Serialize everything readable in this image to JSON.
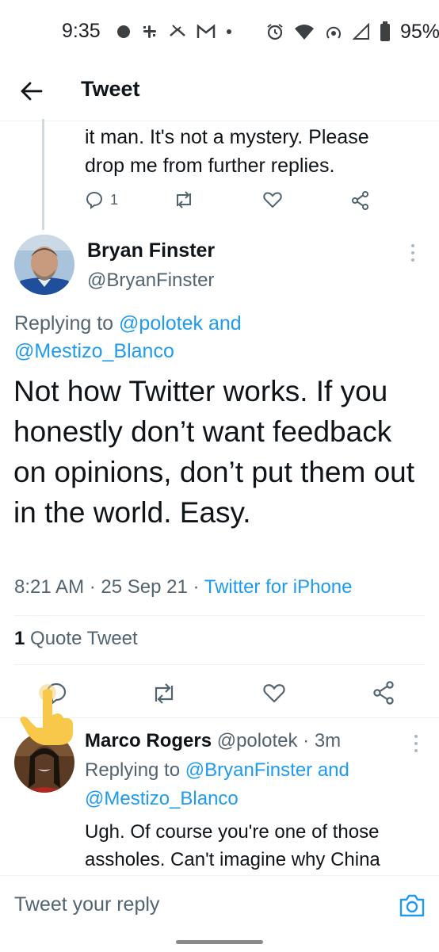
{
  "status_bar": {
    "time": "9:35",
    "battery": "95%"
  },
  "header": {
    "title": "Tweet"
  },
  "previous_tweet": {
    "text_line1": "it man. It's not a mystery. Please",
    "text_line2": "drop me from further replies.",
    "reply_count": "1"
  },
  "main_tweet": {
    "author_name": "Bryan Finster",
    "author_handle": "@BryanFinster",
    "replying_prefix": "Replying to ",
    "replying_user1": "@polotek",
    "replying_and": " and",
    "replying_user2": "@Mestizo_Blanco",
    "text": "Not how Twitter works. If you honestly don’t want feedback on opinions, don’t put them out in the world. Easy.",
    "time": "8:21 AM",
    "date": "25 Sep 21",
    "source": "Twitter for iPhone",
    "quote_count": "1",
    "quote_label": "Quote Tweet"
  },
  "reply_tweet": {
    "author_name": "Marco Rogers",
    "author_handle": "@polotek",
    "age": "3m",
    "replying_prefix": "Replying to ",
    "replying_user1": "@BryanFinster",
    "replying_and": " and",
    "replying_user2": "@Mestizo_Blanco",
    "text": "Ugh. Of course you're one of those assholes. Can't imagine why China"
  },
  "compose": {
    "placeholder": "Tweet your reply"
  },
  "colors": {
    "link_blue": "#1d9bf0",
    "text": "#0f1419",
    "secondary": "#536471"
  }
}
